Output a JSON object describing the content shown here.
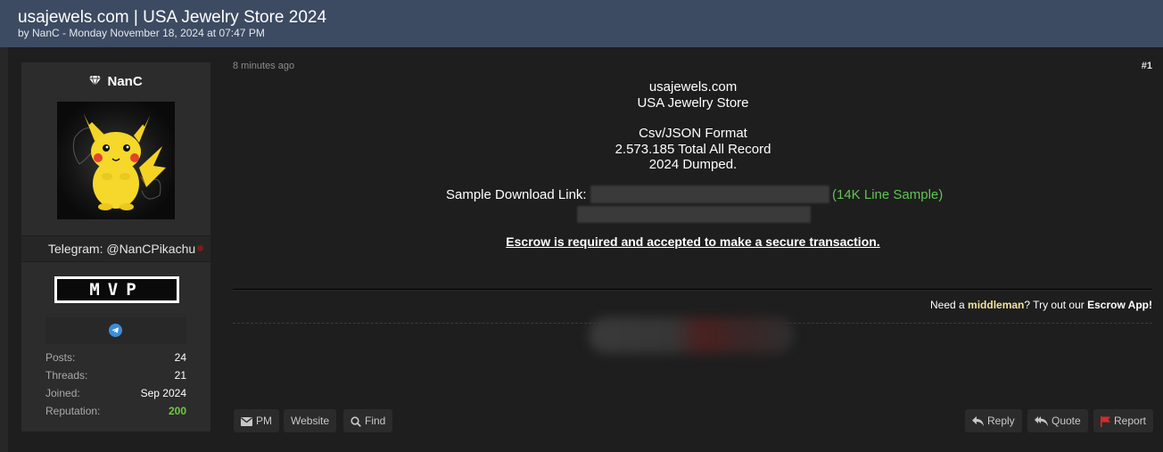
{
  "thread": {
    "title": "usajewels.com | USA Jewelry Store 2024",
    "meta": "by NanC - Monday November 18, 2024 at 07:47 PM"
  },
  "user": {
    "name": "NanC",
    "gem_glyph": "💎",
    "telegram": "Telegram: @NanCPikachu",
    "rank": "MVP",
    "stats": [
      {
        "label": "Posts:",
        "value": "24"
      },
      {
        "label": "Threads:",
        "value": "21"
      },
      {
        "label": "Joined:",
        "value": "Sep 2024"
      },
      {
        "label": "Reputation:",
        "value": "200"
      }
    ],
    "colors": {
      "reputation": "#6fcb3a",
      "status_offline": "#7a1c1c"
    }
  },
  "post": {
    "time": "8 minutes ago",
    "number": "#1",
    "lines": {
      "site": "usajewels.com",
      "store": "USA Jewelry Store",
      "format": "Csv/JSON Format",
      "records": "2.573.185 Total All Record",
      "dumped": "2024 Dumped."
    },
    "sample_label": "Sample Download Link:",
    "sample_note": "(14K Line Sample)",
    "escrow": " Escrow is required and accepted to make a secure transaction.",
    "middleman": {
      "prefix": "Need a ",
      "highlight": "middleman",
      "middle": "? Try out our ",
      "app": "Escrow App!"
    }
  },
  "actions": {
    "pm": "PM",
    "website": "Website",
    "find": "Find",
    "reply": "Reply",
    "quote": "Quote",
    "report": "Report"
  }
}
